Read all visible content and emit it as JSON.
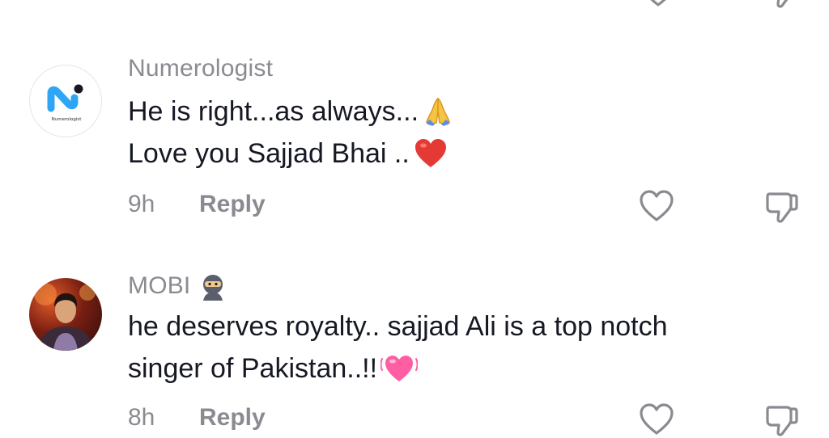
{
  "comments": [
    {
      "username": "Numerologist",
      "avatar": "numerologist-logo",
      "avatar_caption": "Numerologist",
      "line1": "He is right...as always...",
      "line1_emoji": "folded-hands",
      "line2": "Love you Sajjad Bhai ..",
      "line2_emoji": "red-heart",
      "time": "9h",
      "reply_label": "Reply",
      "like_icon": "heart-outline-icon",
      "dislike_icon": "thumbs-down-icon"
    },
    {
      "username": "MOBI",
      "username_emoji": "ninja",
      "avatar": "profile-photo",
      "line1": "he deserves royalty.. sajjad Ali is a top notch",
      "line2": "singer of Pakistan..!!",
      "line2_emoji": "beating-heart",
      "time": "8h",
      "reply_label": "Reply",
      "like_icon": "heart-outline-icon",
      "dislike_icon": "thumbs-down-icon"
    }
  ],
  "colors": {
    "text_primary": "#161823",
    "text_secondary": "#8a8b91",
    "heart_red": "#e53935",
    "pink_heart": "#ff5fa2",
    "logo_blue": "#2fa6f5"
  }
}
